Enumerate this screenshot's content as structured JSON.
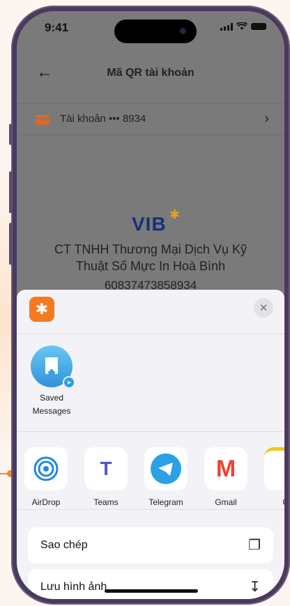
{
  "status_bar": {
    "time": "9:41"
  },
  "nav": {
    "back_icon": "arrow-left-icon",
    "title": "Mã QR tài khoản"
  },
  "account": {
    "label": "Tài khoản ••• 8934"
  },
  "card": {
    "bank_logo": "VIB",
    "company": "CT TNHH Thương Mại Dịch Vụ Kỹ Thuật Số Mực In Hoà Bình",
    "account_number": "60837473858934"
  },
  "share_sheet": {
    "close_icon": "close-icon",
    "contacts": [
      {
        "name": "Saved Messages"
      }
    ],
    "apps": [
      {
        "name": "AirDrop",
        "color": "#1e88e5"
      },
      {
        "name": "Teams",
        "color": "#5059c9"
      },
      {
        "name": "Telegram",
        "color": "#2aa0e6"
      },
      {
        "name": "Gmail",
        "color": "#ea4335"
      },
      {
        "name": "G"
      }
    ],
    "actions": [
      {
        "label": "Sao chép",
        "icon": "copy-icon"
      },
      {
        "label": "Lưu hình ảnh",
        "icon": "save-image-icon"
      }
    ]
  },
  "colors": {
    "accent": "#f47a20",
    "vib_blue": "#18307a"
  }
}
